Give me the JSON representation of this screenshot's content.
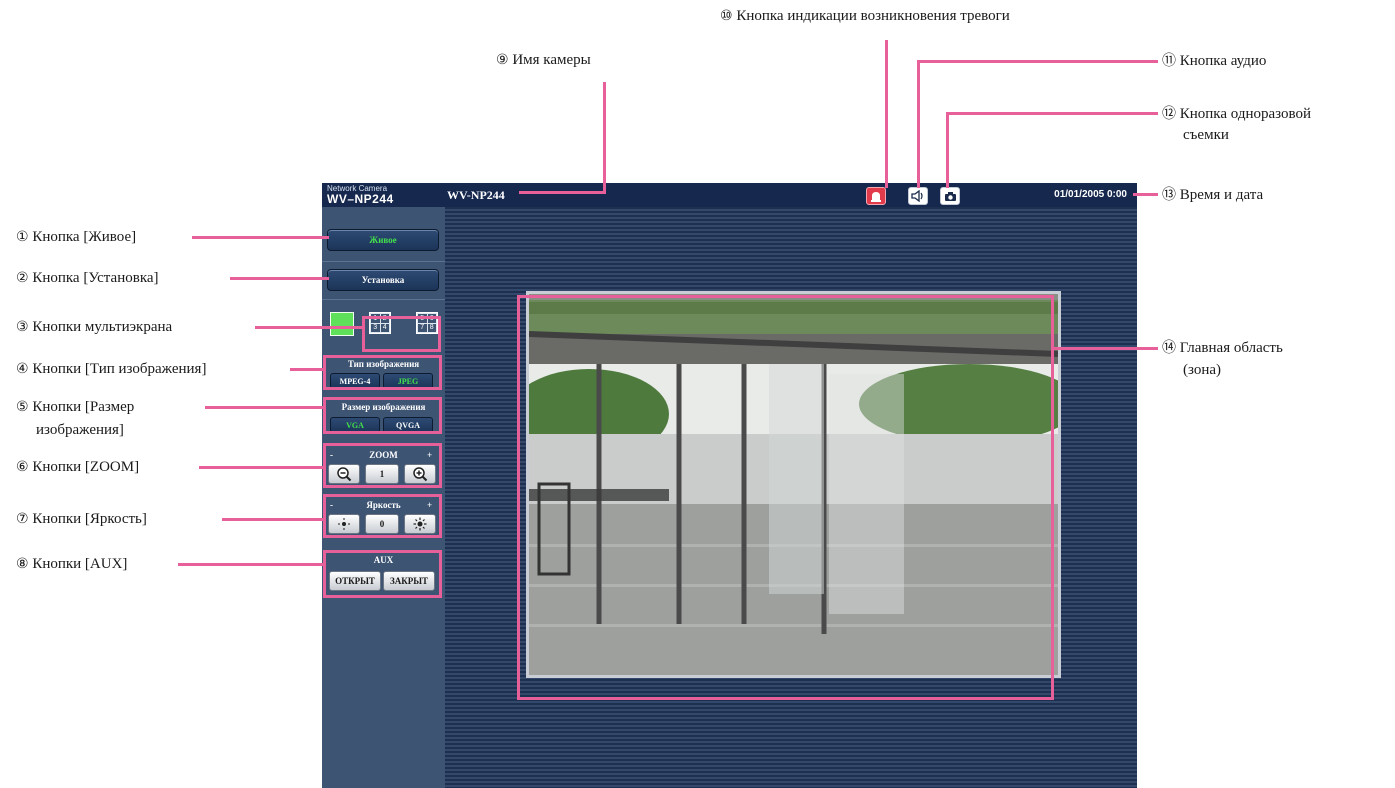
{
  "window": {
    "title": "Network Camera WV-NP244"
  },
  "header": {
    "brand_top": "Network Camera",
    "brand_model": "WV–NP244",
    "camera_name": "WV-NP244",
    "datetime": "01/01/2005 0:00"
  },
  "icons": {
    "alarm": "alarm-bell-icon",
    "audio": "speaker-icon",
    "snapshot": "camera-icon"
  },
  "sidebar": {
    "live_label": "Живое",
    "setup_label": "Установка",
    "multiscreen": {
      "single": "1",
      "quad_a": [
        "1",
        "2",
        "3",
        "4"
      ],
      "quad_b": [
        "5",
        "6",
        "7",
        "8"
      ]
    },
    "image_type": {
      "title": "Тип изображения",
      "options": [
        "MPEG-4",
        "JPEG"
      ],
      "selected": "JPEG"
    },
    "image_size": {
      "title": "Размер изображения",
      "options": [
        "VGA",
        "QVGA"
      ],
      "selected": "VGA"
    },
    "zoom": {
      "minus": "-",
      "title": "ZOOM",
      "plus": "+",
      "reset": "1"
    },
    "brightness": {
      "minus": "-",
      "title": "Яркость",
      "plus": "+",
      "reset": "0"
    },
    "aux": {
      "title": "AUX",
      "open": "ОТКРЫТ",
      "close": "ЗАКРЫТ"
    }
  },
  "colors": {
    "accent_annotation": "#e8609a",
    "selected_text": "#42e04b",
    "topbar": "#16284d",
    "sidebar": "#3d5473"
  },
  "callouts": {
    "c1": {
      "num": "①",
      "text": "Кнопка [Живое]"
    },
    "c2": {
      "num": "②",
      "text": "Кнопка [Установка]"
    },
    "c3": {
      "num": "③",
      "text": "Кнопки мультиэкрана"
    },
    "c4": {
      "num": "④",
      "text": "Кнопки [Тип изображения]"
    },
    "c5": {
      "num": "⑤",
      "text": "Кнопки [Размер",
      "text2": "изображения]"
    },
    "c6": {
      "num": "⑥",
      "text": "Кнопки [ZOOM]"
    },
    "c7": {
      "num": "⑦",
      "text": "Кнопки [Яркость]"
    },
    "c8": {
      "num": "⑧",
      "text": "Кнопки [AUX]"
    },
    "c9": {
      "num": "⑨",
      "text": "Имя камеры"
    },
    "c10": {
      "num": "⑩",
      "text": "Кнопка индикации возникновения тревоги"
    },
    "c11": {
      "num": "⑪",
      "text": "Кнопка аудио"
    },
    "c12": {
      "num": "⑫",
      "text": "Кнопка одноразовой",
      "text2": "съемки"
    },
    "c13": {
      "num": "⑬",
      "text": "Время и дата"
    },
    "c14": {
      "num": "⑭",
      "text": "Главная область",
      "text2": "(зона)"
    }
  }
}
